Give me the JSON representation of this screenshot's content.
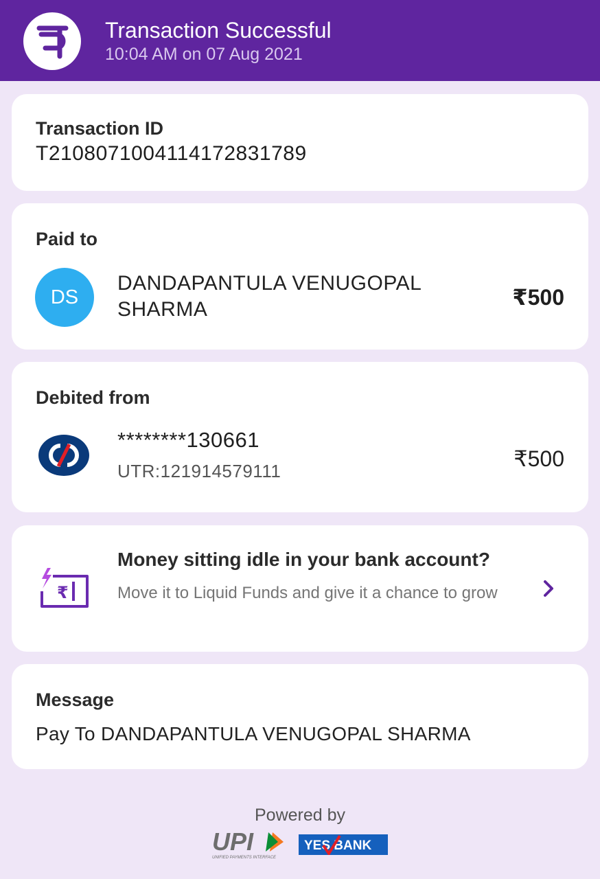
{
  "header": {
    "title": "Transaction Successful",
    "subtitle": "10:04 AM on 07 Aug 2021",
    "logo_icon": "phonepe-logo-icon",
    "bg_color": "#5f259f"
  },
  "transaction": {
    "label": "Transaction ID",
    "id": "T2108071004114172831789"
  },
  "paid_to": {
    "label": "Paid to",
    "avatar_initials": "DS",
    "name": "DANDAPANTULA  VENUGOPAL SHARMA",
    "amount": "₹500"
  },
  "debited_from": {
    "label": "Debited from",
    "bank_icon": "kotak-bank-logo-icon",
    "account": "********130661",
    "utr": "UTR:121914579111",
    "amount": "₹500"
  },
  "promo": {
    "icon": "rupee-wallet-icon",
    "title": "Money sitting idle in your bank account?",
    "text": "Move it to Liquid Funds and give it a chance to grow",
    "chevron_icon": "chevron-right-icon"
  },
  "message": {
    "label": "Message",
    "text": "Pay To DANDAPANTULA  VENUGOPAL SHARMA"
  },
  "footer": {
    "powered_by": "Powered by",
    "upi_logo": "UPI",
    "upi_tagline": "UNIFIED PAYMENTS INTERFACE",
    "bank_logo": "YES BANK"
  }
}
